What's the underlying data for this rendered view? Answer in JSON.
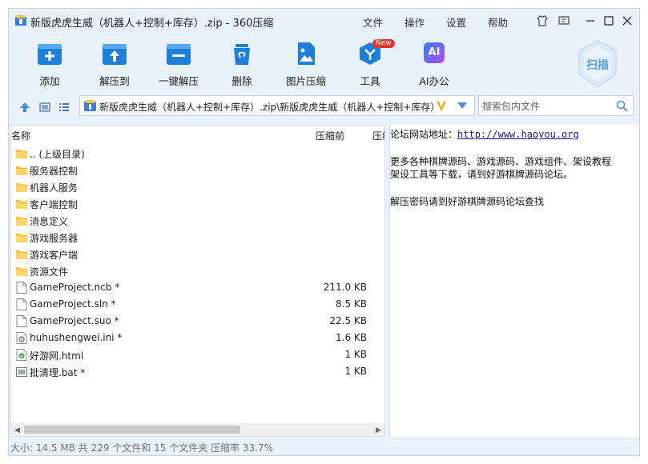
{
  "window": {
    "title": "新版虎虎生威（机器人+控制+库存）.zip - 360压缩",
    "menu": [
      "文件",
      "操作",
      "设置",
      "帮助"
    ]
  },
  "toolbar": {
    "items": [
      {
        "label": "添加",
        "icon": "add-icon"
      },
      {
        "label": "解压到",
        "icon": "extract-to-icon"
      },
      {
        "label": "一键解压",
        "icon": "one-click-extract-icon"
      },
      {
        "label": "删除",
        "icon": "delete-icon"
      },
      {
        "label": "图片压缩",
        "icon": "image-compress-icon"
      },
      {
        "label": "工具",
        "icon": "tools-icon",
        "badge": "New"
      },
      {
        "label": "AI办公",
        "icon": "ai-office-icon",
        "icon_text": "AI"
      }
    ],
    "scan_label": "扫描"
  },
  "address": {
    "path": "新版虎虎生威（机器人+控制+库存）.zip\\新版虎虎生威（机器人+控制+库存）",
    "search_placeholder": "搜索包内文件"
  },
  "columns": {
    "name": "名称",
    "before": "压缩前",
    "after": "压缩"
  },
  "files": [
    {
      "name": ".. (上级目录)",
      "size": "",
      "type": "folder"
    },
    {
      "name": "服务器控制",
      "size": "",
      "type": "folder"
    },
    {
      "name": "机器人服务",
      "size": "",
      "type": "folder"
    },
    {
      "name": "客户端控制",
      "size": "",
      "type": "folder"
    },
    {
      "name": "消息定义",
      "size": "",
      "type": "folder"
    },
    {
      "name": "游戏服务器",
      "size": "",
      "type": "folder"
    },
    {
      "name": "游戏客户端",
      "size": "",
      "type": "folder"
    },
    {
      "name": "资源文件",
      "size": "",
      "type": "folder"
    },
    {
      "name": "GameProject.ncb *",
      "size": "211.0 KB",
      "type": "file"
    },
    {
      "name": "GameProject.sln *",
      "size": "8.5 KB",
      "type": "file"
    },
    {
      "name": "GameProject.suo *",
      "size": "22.5 KB",
      "type": "file"
    },
    {
      "name": "huhushengwei.ini *",
      "size": "1.6 KB",
      "type": "ini"
    },
    {
      "name": "好游网.html",
      "size": "1 KB",
      "type": "html"
    },
    {
      "name": "批清理.bat *",
      "size": "1 KB",
      "type": "bat"
    }
  ],
  "comment": {
    "site_label": "论坛网站地址：",
    "site_url": "http://www.haoyou.org",
    "line2": "更多各种棋牌源码、游戏源码、游戏组件、架设教程",
    "line3": "架设工具等下载，请到好游棋牌源码论坛。",
    "line4": "解压密码请到好游棋牌源码论坛查找"
  },
  "status": "大小: 14.5 MB 共 229 个文件和 15 个文件夹 压缩率 33.7%",
  "colors": {
    "accent": "#1e7fd8",
    "window_bg": "#e9f1fb",
    "folder": "#f5c242"
  }
}
